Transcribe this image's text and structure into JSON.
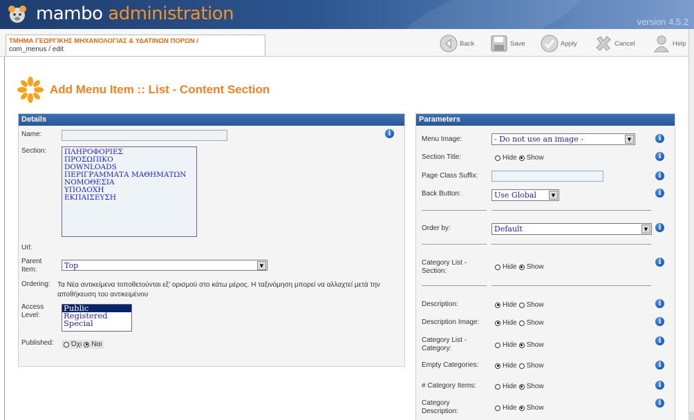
{
  "header": {
    "logo_word1": "mambo",
    "logo_word2": "administration",
    "version": "version 4.5.2"
  },
  "breadcrumb": {
    "site": "ΤΜΗΜΑ ΓΕΩΡΓΙΚΗΣ ΜΗΧΑΝΟΛΟΓΙΑΣ & ΥΔΑΤΙΝΩΝ ΠΟΡΩΝ /",
    "path": "com_menus / edit"
  },
  "toolbar": {
    "back": "Back",
    "save": "Save",
    "apply": "Apply",
    "cancel": "Cancel",
    "help": "Help"
  },
  "page_title": "Add Menu Item :: List - Content Section",
  "details": {
    "heading": "Details",
    "name_label": "Name:",
    "name_value": "",
    "section_label": "Section:",
    "sections": [
      "ΠΛΗΡΟΦΟΡΙΕΣ",
      "ΠΡΟΣΩΠΙΚΟ",
      "DOWNLOADS",
      "ΠΕΡΙΓΡΑΜΜΑΤΑ ΜΑΘΗΜΑΤΩΝ",
      "ΝΟΜΟΘΕΣΙΑ",
      "ΥΠΟΔΟΧΗ",
      "ΕΚΠΑΙΣΕΥΣΗ"
    ],
    "url_label": "Url:",
    "parent_label_1": "Parent",
    "parent_label_2": "Item:",
    "parent_value": "Top",
    "ordering_label": "Ordering:",
    "ordering_text_1": "Τα Νέα αντικείμενα τοποθετούνται εξ' ορισμού στο κάτω μέρος. Η ταξινόμηση μπορεί να αλλαχτεί μετά την",
    "ordering_text_2": "αποθήκευση του αντικειμένου",
    "access_label_1": "Access",
    "access_label_2": "Level:",
    "access_options": [
      "Public",
      "Registered",
      "Special"
    ],
    "published_label": "Published:",
    "published_no": "Όχι",
    "published_yes": "Ναι"
  },
  "parameters": {
    "heading": "Parameters",
    "menu_image_label": "Menu Image:",
    "menu_image_value": "- Do not use an image -",
    "section_title_label": "Section Title:",
    "page_class_label": "Page Class Suffix:",
    "page_class_value": "",
    "back_button_label": "Back Button:",
    "back_button_value": "Use Global",
    "order_by_label": "Order by:",
    "order_by_value": "Default",
    "cat_list_section_label_1": "Category List -",
    "cat_list_section_label_2": "Section:",
    "description_label": "Description:",
    "description_image_label": "Description Image:",
    "cat_list_category_label_1": "Category List -",
    "cat_list_category_label_2": "Category:",
    "empty_categories_label": "Empty Categories:",
    "category_items_label": "# Category Items:",
    "category_description_label_1": "Category",
    "category_description_label_2": "Description:",
    "hide": "Hide",
    "show": "Show"
  }
}
